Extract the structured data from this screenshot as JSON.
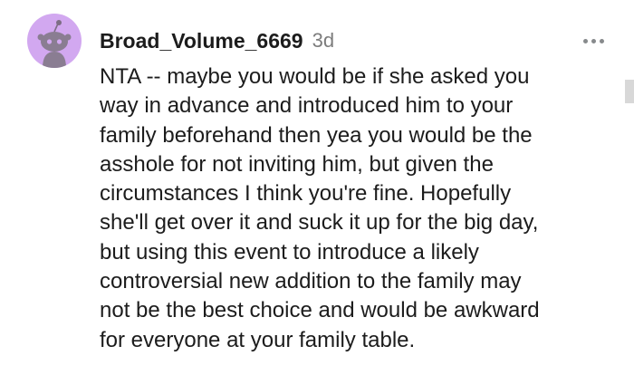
{
  "comment": {
    "author": "Broad_Volume_6669",
    "time_ago": "3d",
    "avatar_icon": "snoo-avatar-icon",
    "avatar_color": "#d2a8f0",
    "more_icon": "more-options-icon",
    "body_lines": [
      "NTA -- maybe you would be if she asked you",
      "way in advance and introduced him to your",
      "family beforehand then yea you would be the",
      "asshole for not inviting him, but given the",
      "circumstances I think you're fine. Hopefully",
      "she'll get over it and suck it up for the big day,",
      "but using this event to introduce a likely",
      "controversial new addition to the family may",
      "not be the best choice and would be awkward",
      "for everyone at your family table."
    ]
  }
}
